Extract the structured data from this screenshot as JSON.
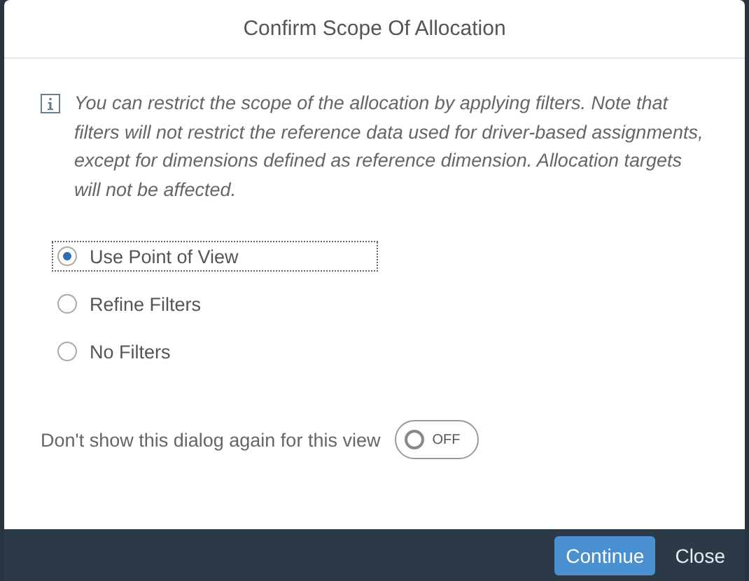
{
  "dialog": {
    "title": "Confirm Scope Of Allocation",
    "info": "You can restrict the scope of the allocation by applying filters. Note that filters will not restrict the reference data used for driver-based assignments, except for dimensions defined as reference dimension. Allocation targets will not be affected.",
    "options": [
      {
        "label": "Use Point of View",
        "selected": true
      },
      {
        "label": "Refine Filters",
        "selected": false
      },
      {
        "label": "No Filters",
        "selected": false
      }
    ],
    "toggle": {
      "label": "Don't show this dialog again for this view",
      "on": false,
      "state_text": "OFF"
    },
    "buttons": [
      {
        "label": "Continue",
        "kind": "primary"
      },
      {
        "label": "Close",
        "kind": "plain"
      }
    ]
  }
}
